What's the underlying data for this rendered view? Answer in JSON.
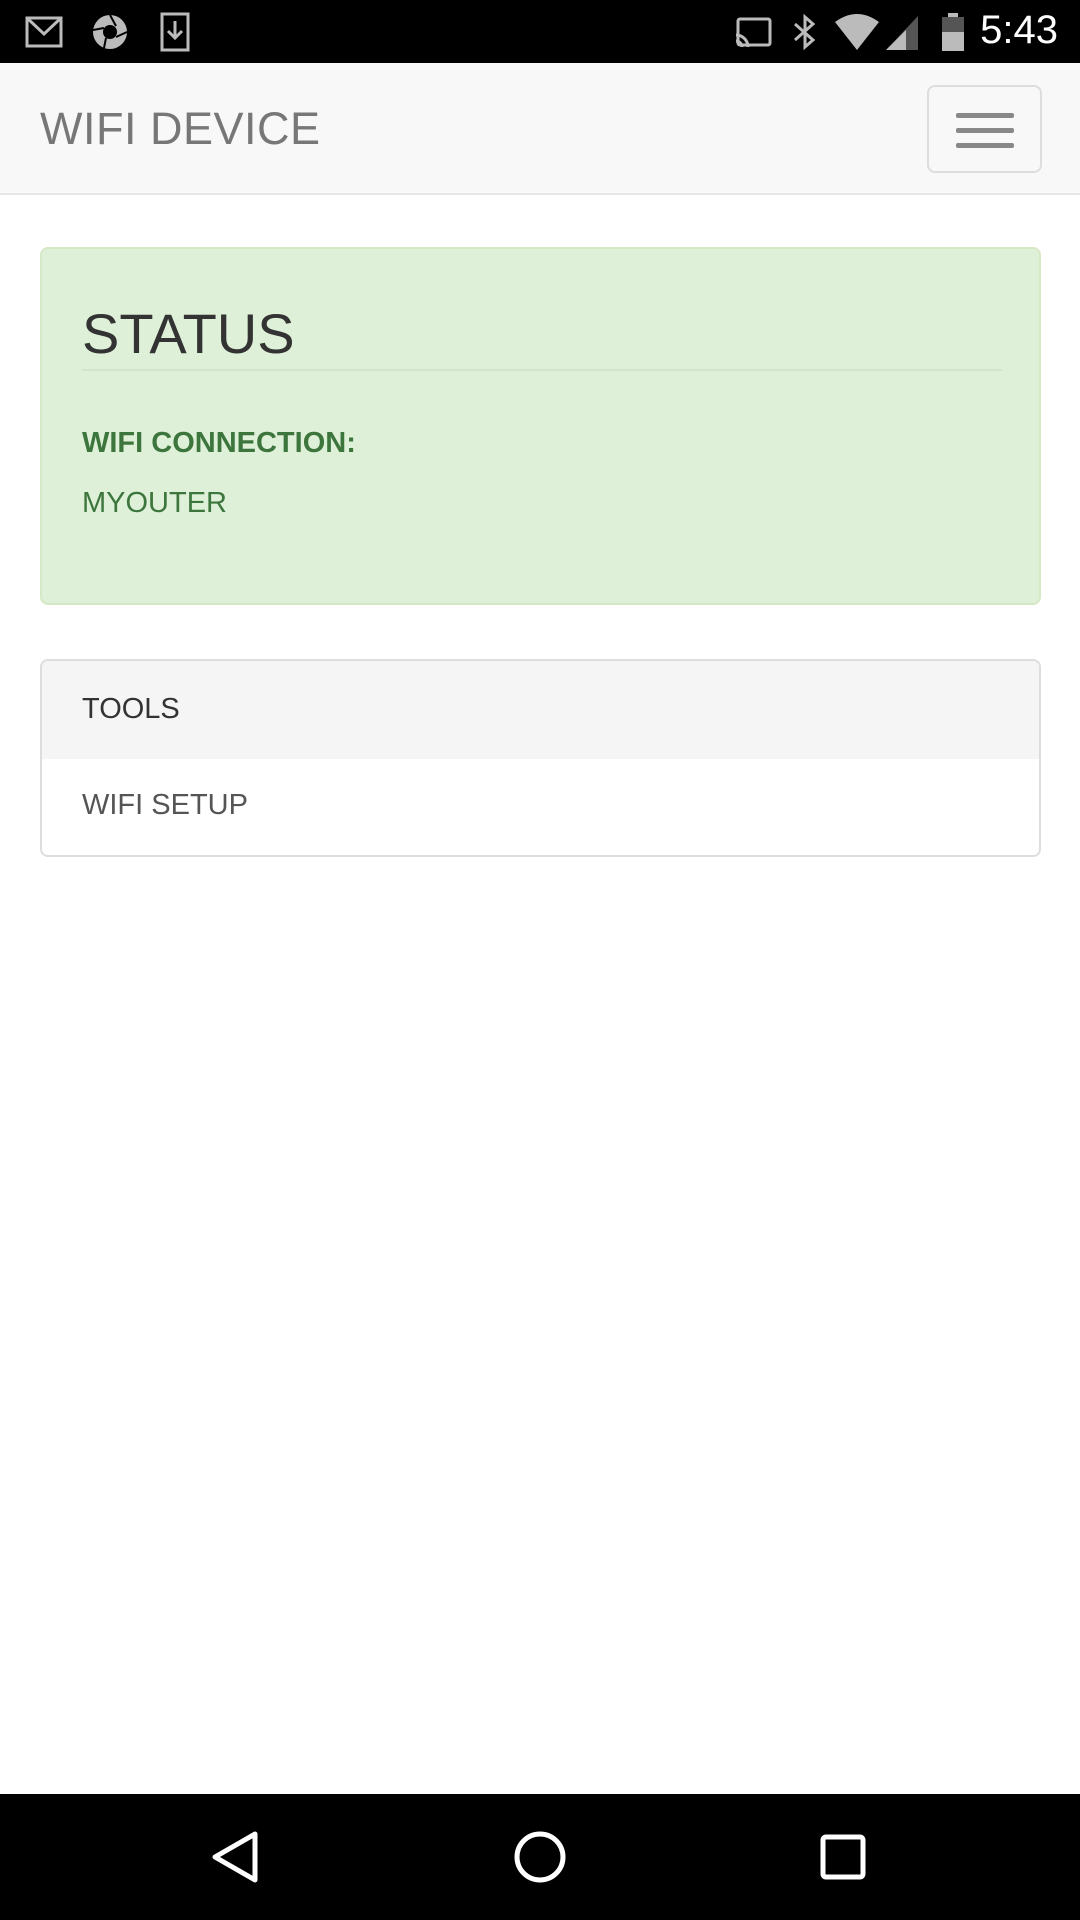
{
  "status_bar": {
    "time": "5:43",
    "icons": [
      "gmail-icon",
      "camera-aperture-icon",
      "download-icon",
      "cast-icon",
      "bluetooth-icon",
      "wifi-signal-icon",
      "cell-signal-icon",
      "battery-icon"
    ]
  },
  "navbar": {
    "brand": "WIFI DEVICE",
    "menu_icon": "hamburger-menu-icon"
  },
  "status_panel": {
    "title": "STATUS",
    "wifi_label": "WIFI CONNECTION:",
    "wifi_value": "MYOUTER"
  },
  "tools_panel": {
    "heading": "TOOLS",
    "items": [
      {
        "label": "WIFI SETUP"
      }
    ]
  },
  "android_nav": {
    "icons": [
      "back-icon",
      "home-icon",
      "recents-icon"
    ]
  },
  "colors": {
    "success_bg": "#dff0d8",
    "success_text": "#3c763d",
    "navbar_bg": "#f8f8f8"
  }
}
